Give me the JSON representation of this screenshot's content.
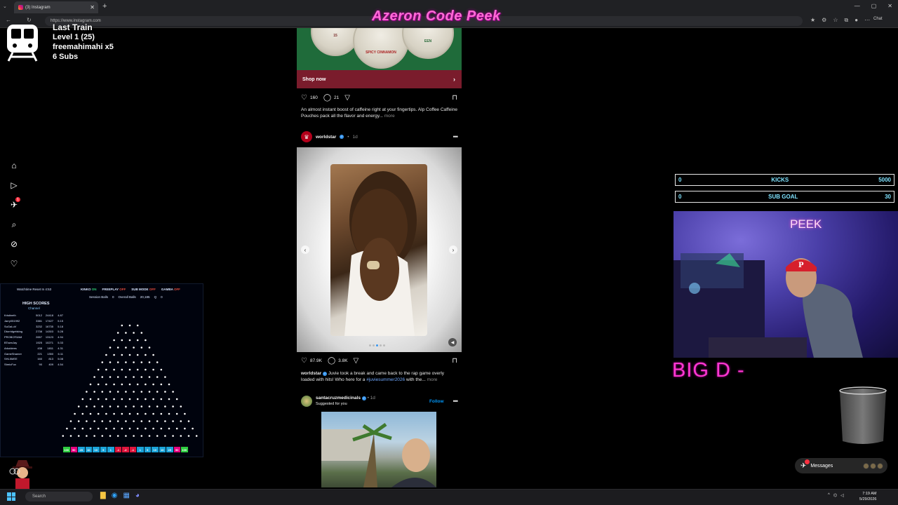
{
  "browser": {
    "tab_title": "(3) Instagram",
    "tab_close": "✕",
    "new_tab": "+",
    "url": "https://www.instagram.com",
    "chat_label": "Chat",
    "window_controls": [
      "—",
      "▢",
      "✕"
    ]
  },
  "stream_title": "Azeron Code Peek",
  "train": {
    "title": "Last Train",
    "level": "Level 1  (25)",
    "user": "freemahimahi x5",
    "subs": "6 Subs"
  },
  "instagram_nav": {
    "items": [
      {
        "icon": "home-icon",
        "glyph": "⌂"
      },
      {
        "icon": "reels-icon",
        "glyph": "▷"
      },
      {
        "icon": "direct-icon",
        "glyph": "✈",
        "badge": "1"
      },
      {
        "icon": "search-icon",
        "glyph": "⌕"
      },
      {
        "icon": "explore-icon",
        "glyph": "⊘"
      },
      {
        "icon": "notifications-icon",
        "glyph": "♡"
      }
    ]
  },
  "ad_post": {
    "tin_labels": [
      "SPICY CINNAMON",
      "EEN"
    ],
    "tin_number": "15",
    "shop_now": "Shop now",
    "likes": "160",
    "comments": "21",
    "caption": "An almost instant boost of caffeine right at your fingertips. Alp Coffee Caffeine Pouches pack all the flavor and energy...",
    "more": "more"
  },
  "worldstar_post": {
    "username": "worldstar",
    "age": "1d",
    "likes": "87.9K",
    "comments": "3.8K",
    "caption_user": "worldstar",
    "caption": "Juvie took a break and came back to the rap game overly loaded with hits! Who here for a",
    "hashtag": "#juviesummer2026",
    "caption_end": "with the...",
    "more": "more"
  },
  "suggested_post": {
    "username": "santacruzmedicinals",
    "age": "1d",
    "subtitle": "Suggested for you",
    "follow": "Follow"
  },
  "goals": [
    {
      "left": "0",
      "label": "KICKS",
      "right": "5000"
    },
    {
      "left": "0",
      "label": "SUB GOAL",
      "right": "30"
    }
  ],
  "webcam_label": "PEEK",
  "big_d": "BIG D -",
  "messages": {
    "label": "Messages",
    "badge": "1"
  },
  "plinko": {
    "timer": "Watchtime Reset In 4:53",
    "status": [
      {
        "label": "KINKO",
        "state": "ON",
        "on": true
      },
      {
        "label": "FREEPLAY",
        "state": "OFF",
        "on": false
      },
      {
        "label": "SUB MODE",
        "state": "OFF",
        "on": false
      },
      {
        "label": "GAMBA",
        "state": "OFF",
        "on": false
      }
    ],
    "session_balls_label": "Session Balls",
    "session_balls": "0",
    "overall_balls_label": "Overall Balls",
    "overall_balls": "20,185",
    "queue": "Q",
    "queue_value": "0",
    "high_scores_title": "HIGH SCORES",
    "high_scores_sub": "Channel",
    "high_scores": [
      {
        "name": "Kristineth",
        "a": "5012",
        "b": "24418",
        "c": "4.87"
      },
      {
        "name": "Jarry051992",
        "a": "3381",
        "b": "17427",
        "c": "5.15"
      },
      {
        "name": "SuGaLuV",
        "a": "3232",
        "b": "16735",
        "c": "5.18"
      },
      {
        "name": "Dtorridgebking",
        "a": "2738",
        "b": "14303",
        "c": "5.28"
      },
      {
        "name": "PROBCR3AM",
        "a": "2657",
        "b": "13123",
        "c": "4.94"
      },
      {
        "name": "BTownJay",
        "a": "1925",
        "b": "10271",
        "c": "5.33"
      },
      {
        "name": "Arkoldees",
        "a": "438",
        "b": "1811",
        "c": "4.31"
      },
      {
        "name": "GameShamer",
        "a": "221",
        "b": "1350",
        "c": "6.11"
      },
      {
        "name": "SHL5MEE",
        "a": "160",
        "b": "813",
        "c": "5.08"
      },
      {
        "name": "StreicFux",
        "a": "90",
        "b": "409",
        "c": "4.54"
      }
    ],
    "slots": [
      {
        "v": "100",
        "c": "#2ecc40"
      },
      {
        "v": "50",
        "c": "#e6007e"
      },
      {
        "v": "25",
        "c": "#1aa3d9"
      },
      {
        "v": "10",
        "c": "#1aa3d9"
      },
      {
        "v": "10",
        "c": "#1aa3d9"
      },
      {
        "v": "5",
        "c": "#1aa3d9"
      },
      {
        "v": "1",
        "c": "#1aa3d9"
      },
      {
        "v": "-1",
        "c": "#e0143c"
      },
      {
        "v": "-2",
        "c": "#e0143c"
      },
      {
        "v": "-1",
        "c": "#e0143c"
      },
      {
        "v": "1",
        "c": "#1aa3d9"
      },
      {
        "v": "5",
        "c": "#1aa3d9"
      },
      {
        "v": "10",
        "c": "#1aa3d9"
      },
      {
        "v": "10",
        "c": "#1aa3d9"
      },
      {
        "v": "25",
        "c": "#1aa3d9"
      },
      {
        "v": "50",
        "c": "#e6007e"
      },
      {
        "v": "100",
        "c": "#2ecc40"
      }
    ]
  },
  "taskbar": {
    "search_placeholder": "Search",
    "time": "7:19 AM",
    "date": "5/29/2026"
  }
}
